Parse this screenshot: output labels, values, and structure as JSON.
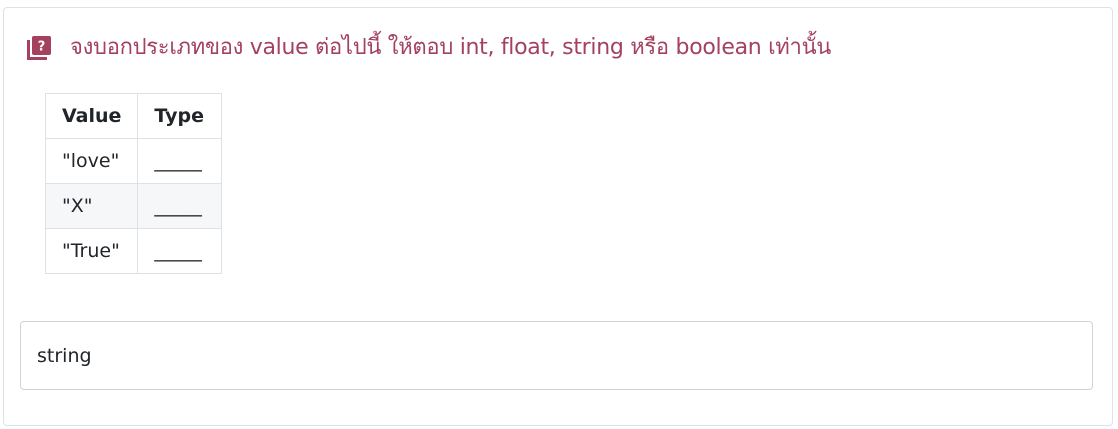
{
  "question": {
    "icon": "question-book-icon",
    "title": "จงบอกประเภทของ value ต่อไปนี้ ให้ตอบ int, float, string หรือ boolean เท่านั้น",
    "accent_color": "#a3415f"
  },
  "table": {
    "headers": [
      "Value",
      "Type"
    ],
    "rows": [
      {
        "value": "\"love\"",
        "type": "_____"
      },
      {
        "value": "\"X\"",
        "type": "_____"
      },
      {
        "value": "\"True\"",
        "type": "_____"
      }
    ]
  },
  "answer": {
    "value": "string"
  }
}
